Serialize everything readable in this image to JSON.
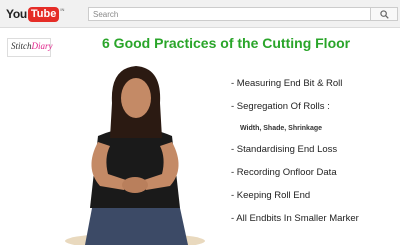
{
  "header": {
    "logo_text_you": "You",
    "logo_text_tube": "Tube",
    "logo_region": "IN",
    "search_placeholder": "Search",
    "search_icon": "search-icon"
  },
  "video": {
    "channel_logo_prefix": "Stitch",
    "channel_logo_highlight": "Diary",
    "title": "6 Good Practices of the Cutting Floor",
    "bullets": [
      "- Measuring End Bit & Roll",
      "- Segregation Of Rolls :",
      "Width, Shade, Shrinkage",
      "- Standardising End Loss",
      "- Recording Onfloor Data",
      "- Keeping Roll End",
      "- All Endbits In Smaller Marker"
    ]
  },
  "colors": {
    "title_green": "#2aa52a",
    "youtube_red": "#e52d27"
  }
}
